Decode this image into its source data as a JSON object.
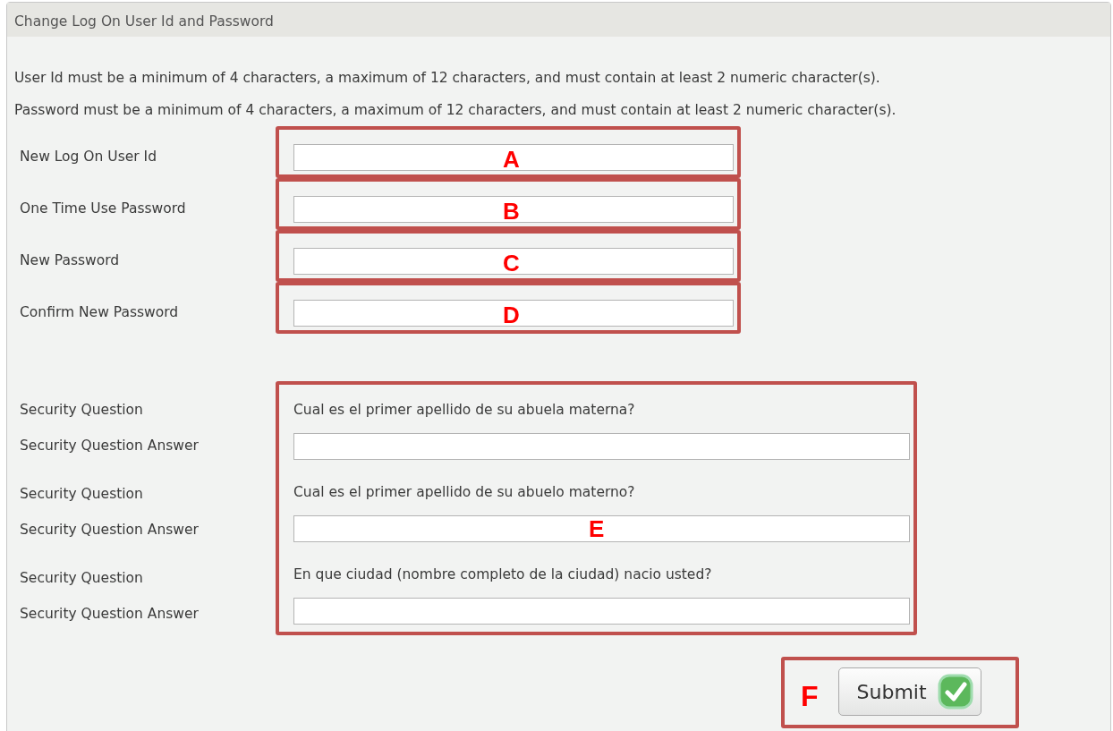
{
  "title": "Change Log On User Id and Password",
  "rules": [
    "User Id must be a minimum of 4 characters, a maximum of 12 characters, and must contain at least 2 numeric character(s).",
    "Password must be a minimum of 4 characters, a maximum of 12 characters, and must contain at least 2 numeric character(s)."
  ],
  "fields": [
    {
      "label": "New Log On User Id",
      "annotation": "A"
    },
    {
      "label": "One Time Use Password",
      "annotation": "B"
    },
    {
      "label": "New Password",
      "annotation": "C"
    },
    {
      "label": "Confirm New Password",
      "annotation": "D"
    }
  ],
  "security": {
    "annotation": "E",
    "items": [
      {
        "question_label": "Security Question",
        "question": "Cual es el primer apellido de su abuela materna?",
        "answer_label": "Security Question Answer"
      },
      {
        "question_label": "Security Question",
        "question": "Cual es el primer apellido de su abuelo materno?",
        "answer_label": "Security Question Answer"
      },
      {
        "question_label": "Security Question",
        "question": "En que ciudad (nombre completo de la ciudad) nacio usted?",
        "answer_label": "Security Question Answer"
      }
    ]
  },
  "submit": {
    "label": "Submit",
    "annotation": "F"
  }
}
